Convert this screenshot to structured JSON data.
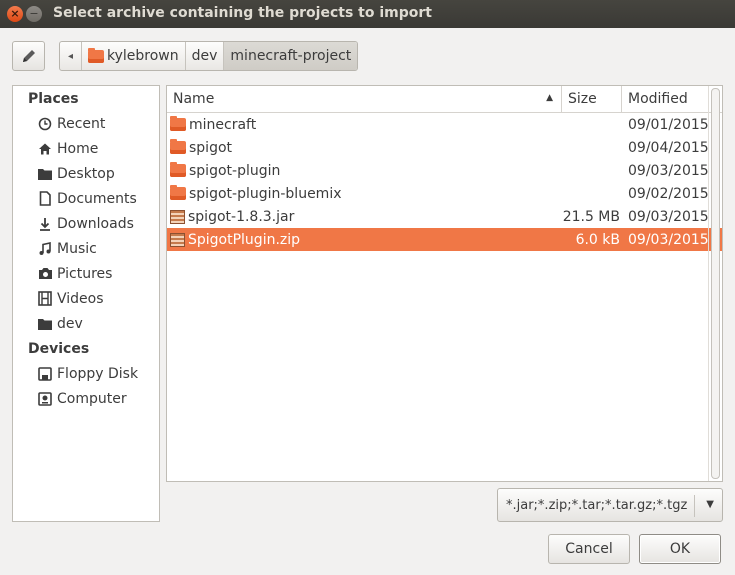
{
  "window": {
    "title": "Select archive containing the projects to import",
    "close_glyph": "×",
    "minimize_glyph": "−"
  },
  "toolbar": {
    "edit_icon": "pencil-icon"
  },
  "pathbar": {
    "segments": [
      {
        "label": "kylebrown",
        "icon": "home-folder-icon"
      },
      {
        "label": "dev"
      },
      {
        "label": "minecraft-project",
        "active": true
      }
    ]
  },
  "sidebar": {
    "places_heading": "Places",
    "places": [
      {
        "label": "Recent",
        "icon": "clock-icon"
      },
      {
        "label": "Home",
        "icon": "home-icon"
      },
      {
        "label": "Desktop",
        "icon": "folder-icon"
      },
      {
        "label": "Documents",
        "icon": "document-icon"
      },
      {
        "label": "Downloads",
        "icon": "download-icon"
      },
      {
        "label": "Music",
        "icon": "music-icon"
      },
      {
        "label": "Pictures",
        "icon": "camera-icon"
      },
      {
        "label": "Videos",
        "icon": "film-icon"
      },
      {
        "label": "dev",
        "icon": "folder-icon"
      }
    ],
    "devices_heading": "Devices",
    "devices": [
      {
        "label": "Floppy Disk",
        "icon": "floppy-icon"
      },
      {
        "label": "Computer",
        "icon": "computer-icon"
      }
    ]
  },
  "filelist": {
    "columns": {
      "name": "Name",
      "size": "Size",
      "modified": "Modified"
    },
    "rows": [
      {
        "name": "minecraft",
        "size": "",
        "modified": "09/01/2015",
        "type": "folder"
      },
      {
        "name": "spigot",
        "size": "",
        "modified": "09/04/2015",
        "type": "folder"
      },
      {
        "name": "spigot-plugin",
        "size": "",
        "modified": "09/03/2015",
        "type": "folder"
      },
      {
        "name": "spigot-plugin-bluemix",
        "size": "",
        "modified": "09/02/2015",
        "type": "folder"
      },
      {
        "name": "spigot-1.8.3.jar",
        "size": "21.5 MB",
        "modified": "09/03/2015",
        "type": "archive"
      },
      {
        "name": "SpigotPlugin.zip",
        "size": "6.0 kB",
        "modified": "09/03/2015",
        "type": "archive",
        "selected": true
      }
    ]
  },
  "filter": {
    "value": "*.jar;*.zip;*.tar;*.tar.gz;*.tgz"
  },
  "buttons": {
    "cancel": "Cancel",
    "ok": "OK"
  },
  "colors": {
    "accent": "#f07746",
    "titlebar": "#3c3b37"
  }
}
